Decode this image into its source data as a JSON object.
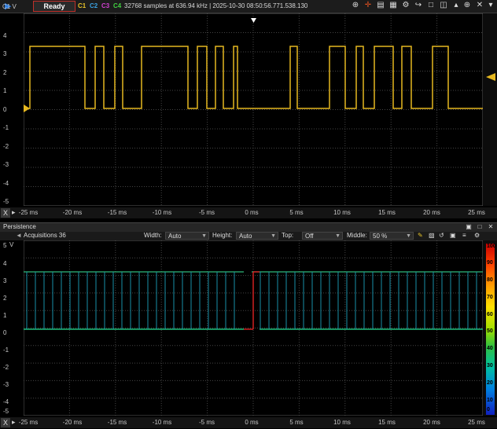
{
  "toolbar": {
    "status": "Ready",
    "channels": [
      {
        "label": "C1",
        "color": "#e6c229"
      },
      {
        "label": "C2",
        "color": "#3aa0e0"
      },
      {
        "label": "C3",
        "color": "#d040d0"
      },
      {
        "label": "C4",
        "color": "#40d040"
      }
    ],
    "info": "32768 samples at 636.94 kHz  |  2025-10-30 08:50:56.771.538.130"
  },
  "scope": {
    "corner_label": "C1 V",
    "y_ticks": [
      "4",
      "3",
      "2",
      "1",
      "0",
      "-1",
      "-2",
      "-3",
      "-4",
      "-5"
    ],
    "x_ticks": [
      "-25 ms",
      "-20 ms",
      "-15 ms",
      "-10 ms",
      "-5 ms",
      "0 ms",
      "5 ms",
      "10 ms",
      "15 ms",
      "20 ms",
      "25 ms"
    ],
    "x_button": "X",
    "trace_color": "#e6b820"
  },
  "persistence": {
    "title": "Persistence",
    "acquisitions": "Acquisitions 36",
    "width_label": "Width:",
    "width_value": "Auto",
    "height_label": "Height:",
    "height_value": "Auto",
    "top_label": "Top:",
    "top_value": "Off",
    "middle_label": "Middle:",
    "middle_value": "50 %",
    "y_ticks": [
      "5",
      "4",
      "3",
      "2",
      "1",
      "0",
      "-1",
      "-2",
      "-3",
      "-4",
      "-5"
    ],
    "corner_label": "V",
    "x_ticks": [
      "-25 ms",
      "-20 ms",
      "-15 ms",
      "-10 ms",
      "-5 ms",
      "0 ms",
      "5 ms",
      "10 ms",
      "15 ms",
      "20 ms",
      "25 ms"
    ],
    "x_button": "X",
    "colorbar_labels": [
      "100",
      "90",
      "80",
      "70",
      "60",
      "50",
      "40",
      "30",
      "20",
      "10",
      "0"
    ]
  }
}
